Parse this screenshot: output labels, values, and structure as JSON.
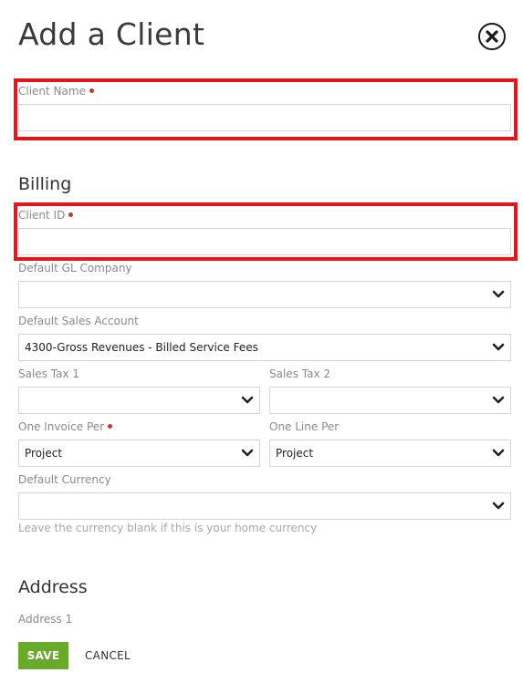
{
  "dialog": {
    "title": "Add a Client"
  },
  "client_name": {
    "label": "Client Name",
    "value": ""
  },
  "billing": {
    "heading": "Billing",
    "client_id": {
      "label": "Client ID",
      "value": ""
    },
    "default_gl_company": {
      "label": "Default GL Company",
      "value": ""
    },
    "default_sales_account": {
      "label": "Default Sales Account",
      "value": "4300-Gross Revenues - Billed Service Fees"
    },
    "sales_tax_1": {
      "label": "Sales Tax 1",
      "value": ""
    },
    "sales_tax_2": {
      "label": "Sales Tax 2",
      "value": ""
    },
    "one_invoice_per": {
      "label": "One Invoice Per",
      "value": "Project"
    },
    "one_line_per": {
      "label": "One Line Per",
      "value": "Project"
    },
    "default_currency": {
      "label": "Default Currency",
      "value": "",
      "hint": "Leave the currency blank if this is your home currency"
    }
  },
  "address": {
    "heading": "Address",
    "address_1": {
      "label": "Address 1"
    }
  },
  "actions": {
    "save_label": "SAVE",
    "cancel_label": "CANCEL"
  },
  "colors": {
    "highlight": "#e8141c",
    "save_button": "#6aaa2a",
    "required_dot": "#c0392b"
  },
  "icons": {
    "close": "close-circle-icon",
    "dropdown": "chevron-down-icon"
  }
}
